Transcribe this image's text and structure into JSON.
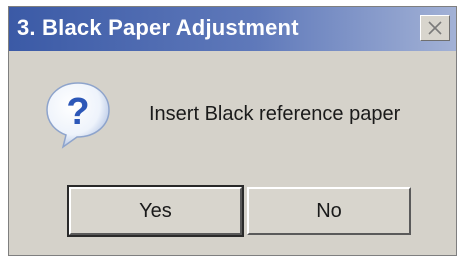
{
  "window": {
    "title": "3. Black Paper Adjustment",
    "close_icon": "close-icon"
  },
  "dialog": {
    "icon": "question-icon",
    "message": "Insert Black reference paper"
  },
  "buttons": {
    "yes_label": "Yes",
    "no_label": "No"
  },
  "colors": {
    "title_bar_start": "#3b5aa6",
    "title_bar_end": "#a3b2d6",
    "dialog_background": "#d5d2ca",
    "icon_blue": "#2c57b8"
  }
}
